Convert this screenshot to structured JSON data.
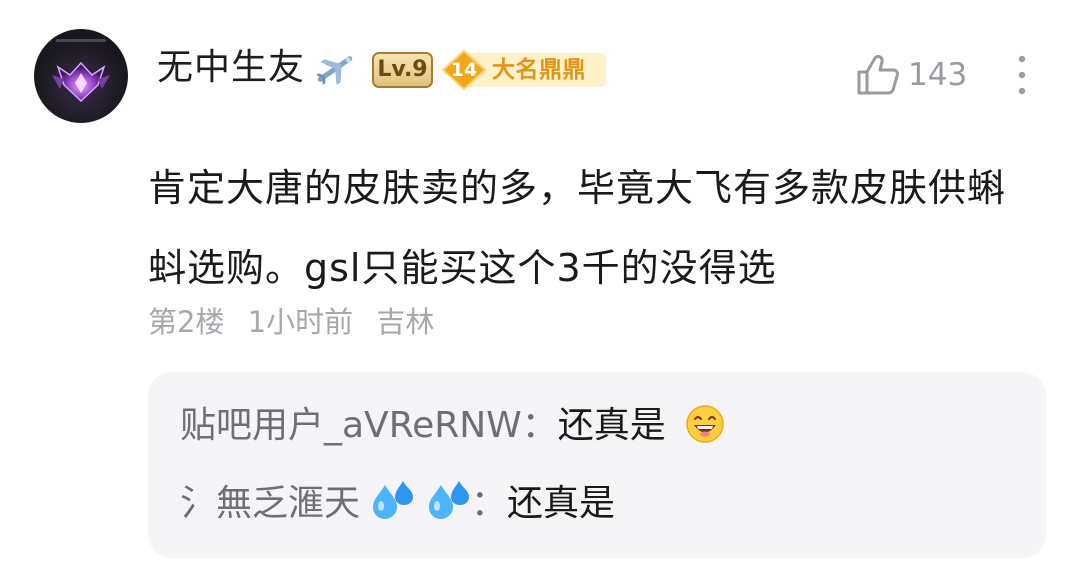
{
  "post": {
    "username": "无中生友",
    "username_icon": "airplane-icon",
    "level_label": "Lv.9",
    "rank_number": "14",
    "rank_title": "大名鼎鼎",
    "likes": "143",
    "comment_lines": [
      "肯定大唐的皮肤卖的多，毕竟大飞有多款皮肤供蝌",
      "蚪选购。gsl只能买这个3千的没得选"
    ],
    "floor": "第2楼",
    "time": "1小时前",
    "location": "吉林"
  },
  "replies": [
    {
      "author": "贴吧用户_aVReRNW",
      "separator": "：",
      "text": "还真是",
      "emoji": "grinning-face-emoji"
    },
    {
      "author": "氵無乏滙天",
      "separator": "：",
      "text": "还真是",
      "emoji": "sweat-droplets-emoji"
    }
  ],
  "colors": {
    "badge_gold": "#e0951a",
    "meta_gray": "#a7a7ae",
    "reply_bg": "#f5f5f7"
  }
}
